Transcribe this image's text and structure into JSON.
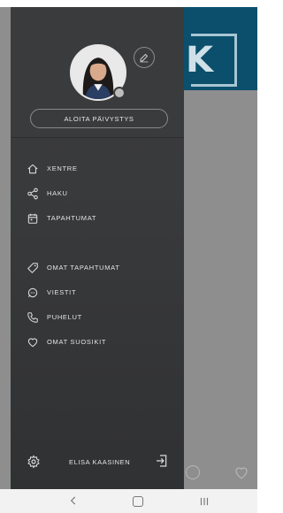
{
  "drawer": {
    "start_shift_label": "ALOITA PÄIVYSTYS",
    "menu": [
      {
        "label": "XENTRE",
        "icon": "home-icon"
      },
      {
        "label": "HAKU",
        "icon": "share-icon"
      },
      {
        "label": "TAPAHTUMAT",
        "icon": "calendar-icon"
      },
      {
        "label": "OMAT TAPAHTUMAT",
        "icon": "tag-icon"
      },
      {
        "label": "VIESTIT",
        "icon": "chat-icon"
      },
      {
        "label": "PUHELUT",
        "icon": "phone-icon"
      },
      {
        "label": "OMAT SUOSIKIT",
        "icon": "heart-icon"
      }
    ],
    "user_name": "ELISA KAASINEN"
  },
  "colors": {
    "drawer_bg": "#3a3b3d",
    "brand_banner": "#0b4f6c",
    "overlay": "#8e8e8e"
  }
}
